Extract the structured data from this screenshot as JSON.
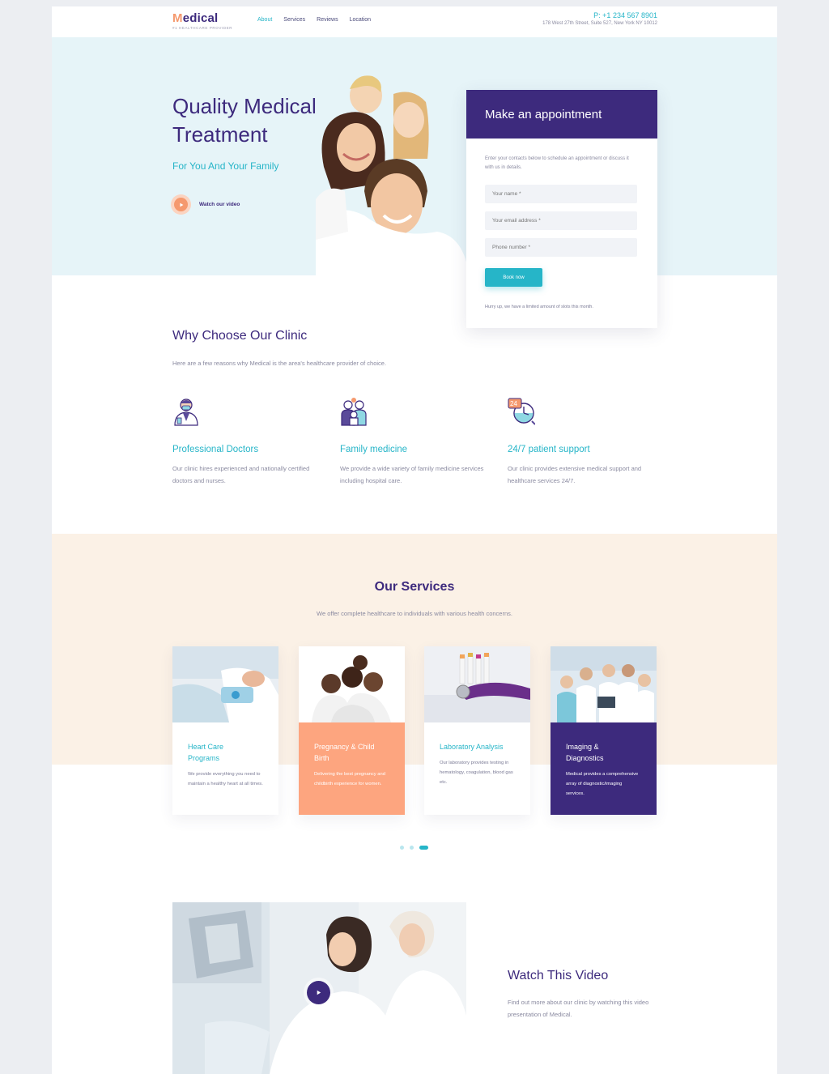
{
  "header": {
    "logo_initial": "M",
    "logo_rest": "edical",
    "logo_tagline": "#1 HEALTHCARE PROVIDER",
    "nav": [
      "About",
      "Services",
      "Reviews",
      "Location"
    ],
    "phone": "P: +1 234 567 8901",
    "address": "178 West 27th Street, Suite 527, New York NY 10012"
  },
  "hero": {
    "title_line1": "Quality Medical",
    "title_line2": "Treatment",
    "subtitle": "For You And Your Family",
    "watch_label": "Watch our video",
    "play_icon": "play-icon"
  },
  "appointment": {
    "title": "Make an appointment",
    "description": "Enter your contacts below to schedule an appointment or discuss it with us in details.",
    "name_placeholder": "Your name *",
    "email_placeholder": "Your email address *",
    "phone_placeholder": "Phone number *",
    "button": "Book now",
    "note": "Hurry up, we have a limited amount of slots this month."
  },
  "why": {
    "title": "Why Choose Our Clinic",
    "subtitle": "Here are a few reasons why Medical is the area's healthcare provider of choice.",
    "features": [
      {
        "icon": "doctor-icon",
        "title": "Professional Doctors",
        "text": "Our clinic hires experienced and nationally certified doctors and nurses."
      },
      {
        "icon": "family-icon",
        "title": "Family medicine",
        "text": "We provide a wide variety of family medicine services including hospital care."
      },
      {
        "icon": "clock-24-icon",
        "title": "24/7 patient support",
        "text": "Our clinic provides extensive medical support and healthcare services 24/7."
      }
    ]
  },
  "services": {
    "title": "Our Services",
    "subtitle": "We offer complete healthcare to individuals with various health concerns.",
    "cards": [
      {
        "title": "Heart Care Programs",
        "text": "We provide everything you need to maintain a healthy heart at all times."
      },
      {
        "title": "Pregnancy & Child Birth",
        "text": "Delivering the best pregnancy and childbirth experience for women."
      },
      {
        "title": "Laboratory Analysis",
        "text": "Our laboratory provides testing in hematology, coagulation, blood gas etc."
      },
      {
        "title": "Imaging & Diagnostics",
        "text": "Medical provides a comprehensive array of diagnostic/imaging services."
      }
    ],
    "active_dot": 3
  },
  "video": {
    "title": "Watch This Video",
    "description": "Find out more about our clinic by watching this video presentation of Medical."
  },
  "colors": {
    "brand_purple": "#3d2a7d",
    "accent_teal": "#26b5c8",
    "accent_orange": "#fda57f",
    "hero_bg": "#e6f4f8",
    "services_bg": "#fbf1e6"
  }
}
